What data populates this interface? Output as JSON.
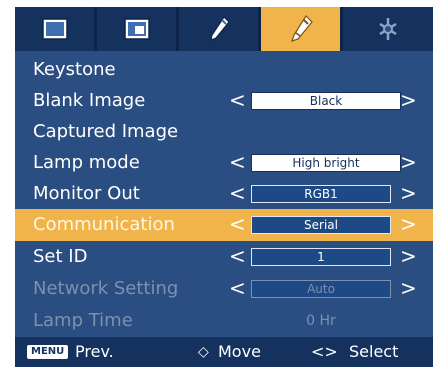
{
  "tabs": [
    {
      "icon": "picture-icon",
      "selected": false
    },
    {
      "icon": "screen-icon",
      "selected": false
    },
    {
      "icon": "setup-pen-icon",
      "selected": false
    },
    {
      "icon": "option-pen-icon",
      "selected": true
    },
    {
      "icon": "settings-icon",
      "selected": false
    }
  ],
  "menu": {
    "keystone": {
      "label": "Keystone"
    },
    "blank_image": {
      "label": "Blank Image",
      "value": "Black"
    },
    "captured_image": {
      "label": "Captured Image"
    },
    "lamp_mode": {
      "label": "Lamp mode",
      "value": "High bright"
    },
    "monitor_out": {
      "label": "Monitor Out",
      "value": "RGB1"
    },
    "communication": {
      "label": "Communication",
      "value": "Serial"
    },
    "set_id": {
      "label": "Set ID",
      "value": "1"
    },
    "network_setting": {
      "label": "Network Setting",
      "value": "Auto"
    },
    "lamp_time": {
      "label": "Lamp Time",
      "value": "0 Hr"
    }
  },
  "arrows": {
    "left": "<",
    "right": ">"
  },
  "footer": {
    "menu_key": "MENU",
    "prev": "Prev.",
    "move_symbol": "◇",
    "move": "Move",
    "select_symbol": "<>",
    "select": "Select"
  },
  "colors": {
    "panel": "#2a4e82",
    "bar": "#15325f",
    "highlight": "#f0b44a",
    "disabled_text": "#7d90ad"
  }
}
